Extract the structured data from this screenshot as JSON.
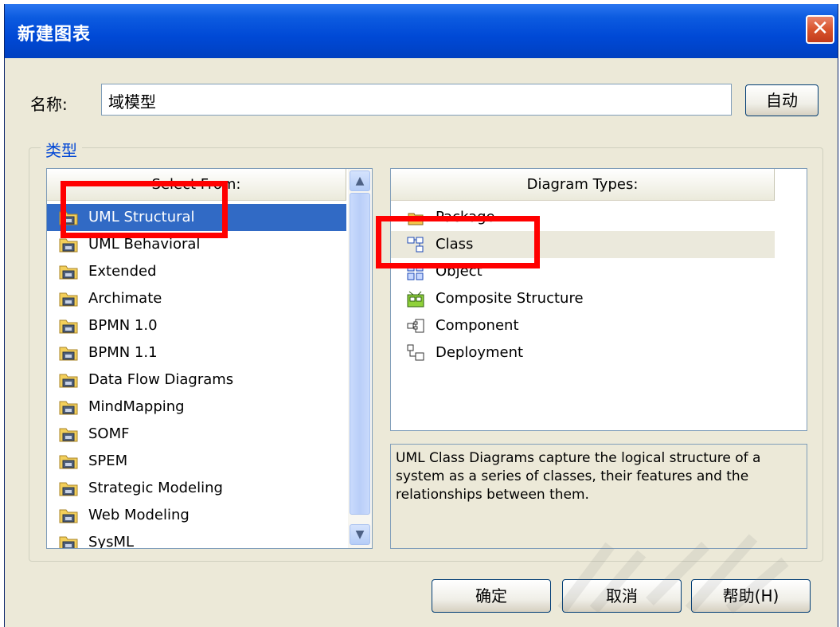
{
  "dialog": {
    "title": "新建图表",
    "close_glyph": "✕"
  },
  "name_field": {
    "label": "名称:",
    "value": "域模型",
    "auto_button": "自动"
  },
  "type_group": {
    "title": "类型",
    "select_from": {
      "header": "Select From:",
      "icon": "folder-package-icon",
      "items": [
        {
          "label": "UML Structural",
          "selected": true
        },
        {
          "label": "UML Behavioral"
        },
        {
          "label": "Extended"
        },
        {
          "label": "Archimate"
        },
        {
          "label": "BPMN 1.0"
        },
        {
          "label": "BPMN 1.1"
        },
        {
          "label": "Data Flow Diagrams"
        },
        {
          "label": "MindMapping"
        },
        {
          "label": "SOMF"
        },
        {
          "label": "SPEM"
        },
        {
          "label": "Strategic Modeling"
        },
        {
          "label": "Web Modeling"
        },
        {
          "label": "SysML"
        }
      ]
    },
    "diagram_types": {
      "header": "Diagram Types:",
      "items": [
        {
          "label": "Package",
          "icon": "package-diagram-icon"
        },
        {
          "label": "Class",
          "icon": "class-diagram-icon",
          "selected": true
        },
        {
          "label": "Object",
          "icon": "object-diagram-icon"
        },
        {
          "label": "Composite Structure",
          "icon": "composite-structure-icon"
        },
        {
          "label": "Component",
          "icon": "component-diagram-icon"
        },
        {
          "label": "Deployment",
          "icon": "deployment-diagram-icon"
        }
      ]
    },
    "description": "UML Class Diagrams capture the logical structure of a system as a series of classes, their features and the relationships between them."
  },
  "buttons": {
    "ok": "确定",
    "cancel": "取消",
    "help": "帮助(H)"
  },
  "colors": {
    "titlebar": "#0049d6",
    "selection": "#316ac5",
    "highlight": "#ff0000",
    "group_title": "#0046d5"
  }
}
